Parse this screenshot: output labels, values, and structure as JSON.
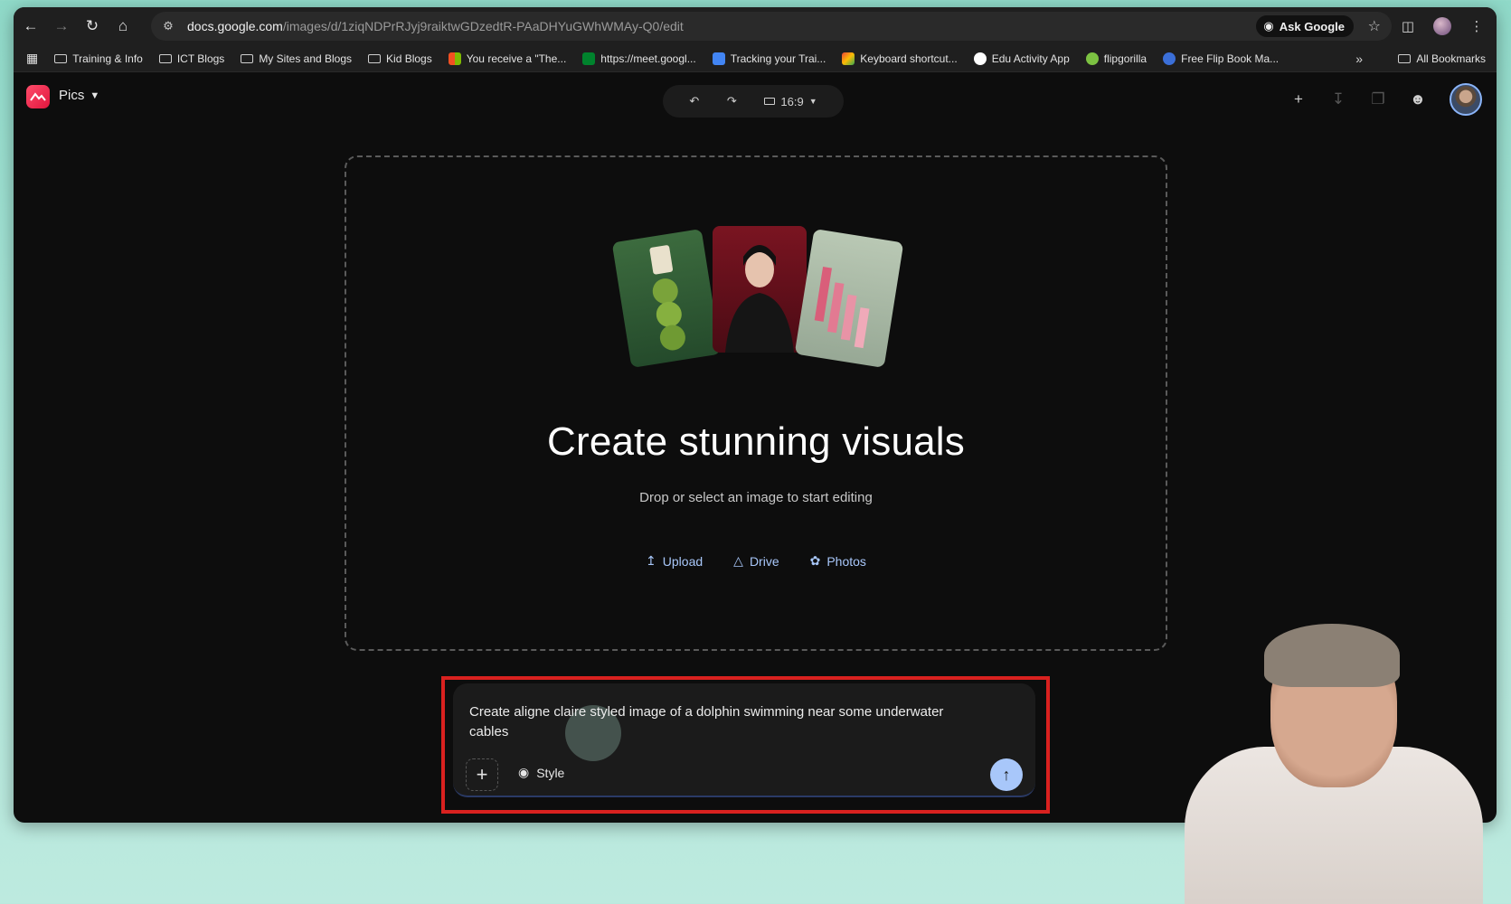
{
  "browser": {
    "url_host": "docs.google.com",
    "url_path": "/images/d/1ziqNDPrRJyj9raiktwGDzedtR-PAaDHYuGWhWMAy-Q0/edit",
    "ask_google": "Ask Google",
    "bookmarks": [
      {
        "label": "Training & Info",
        "icon": "folder-icon"
      },
      {
        "label": "ICT Blogs",
        "icon": "folder-icon"
      },
      {
        "label": "My Sites and Blogs",
        "icon": "folder-icon"
      },
      {
        "label": "Kid Blogs",
        "icon": "folder-icon"
      },
      {
        "label": "You receive a \"The...",
        "icon": "microsoft-icon"
      },
      {
        "label": "https://meet.googl...",
        "icon": "meet-icon"
      },
      {
        "label": "Tracking your Trai...",
        "icon": "doc-icon"
      },
      {
        "label": "Keyboard shortcut...",
        "icon": "gmail-icon"
      },
      {
        "label": "Edu Activity App",
        "icon": "google-icon"
      },
      {
        "label": "flipgorilla",
        "icon": "gorilla-icon"
      },
      {
        "label": "Free Flip Book Ma...",
        "icon": "flipbook-icon"
      }
    ],
    "all_bookmarks": "All Bookmarks"
  },
  "app": {
    "name": "Pics",
    "aspect_ratio": "16:9"
  },
  "hero": {
    "title": "Create stunning visuals",
    "subtitle": "Drop or select an image to start editing",
    "sources": [
      "Upload",
      "Drive",
      "Photos"
    ]
  },
  "prompt": {
    "text": "Create aligne claire styled image of a dolphin swimming near some underwater cables",
    "style_label": "Style"
  },
  "colors": {
    "accent": "#a8c7fa",
    "highlight": "#d9211f",
    "background": "#0d0d0d"
  }
}
